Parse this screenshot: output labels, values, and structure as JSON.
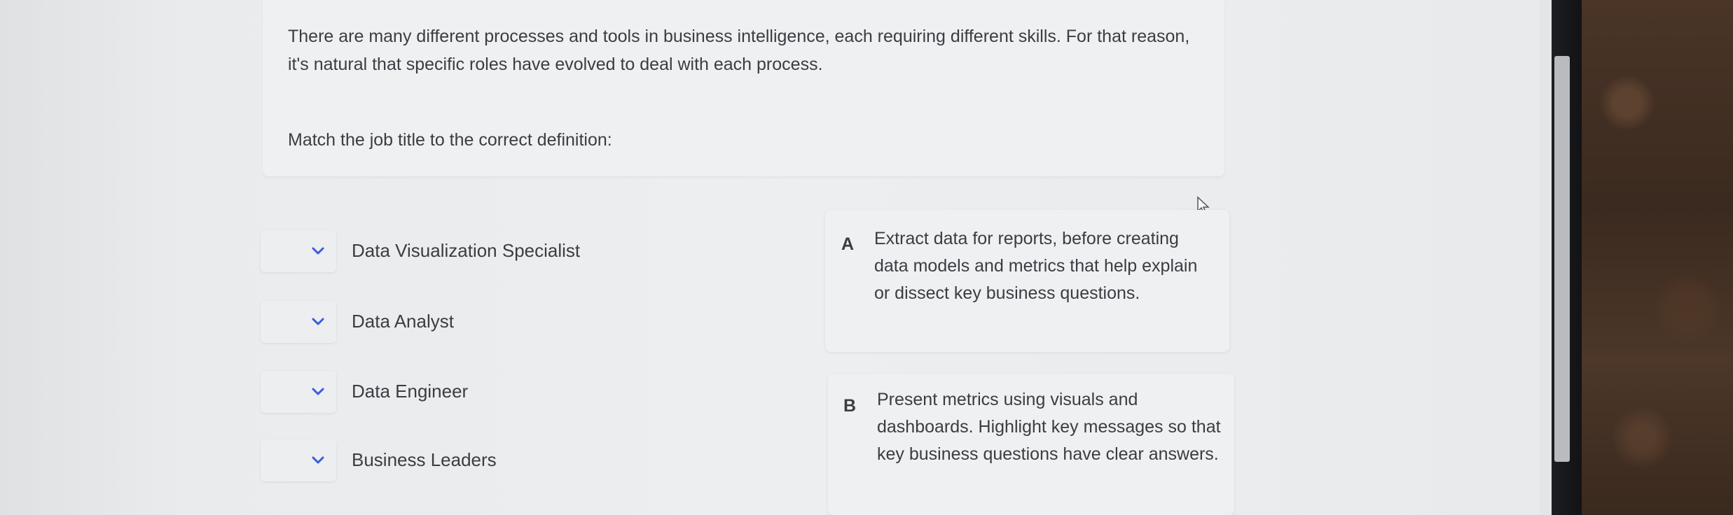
{
  "question": {
    "prompt": "There are many different processes and tools in business intelligence, each requiring different skills. For that reason, it's natural that specific roles have evolved to deal with each process.",
    "instruction": "Match the job title to the correct definition:"
  },
  "job_titles": [
    {
      "label": "Data Visualization Specialist",
      "icon": "chevron-down-icon"
    },
    {
      "label": "Data Analyst",
      "icon": "chevron-down-icon"
    },
    {
      "label": "Data Engineer",
      "icon": "chevron-down-icon"
    },
    {
      "label": "Business Leaders",
      "icon": "chevron-down-icon"
    }
  ],
  "definitions": [
    {
      "letter": "A",
      "text": "Extract data for reports, before creating data models and metrics that help explain or dissect key business questions."
    },
    {
      "letter": "B",
      "text": "Present metrics using visuals and dashboards. Highlight key messages so that key business questions have clear answers."
    }
  ],
  "colors": {
    "accent": "#3b5bdb",
    "text": "#3a3d42",
    "card": "#eef0f2"
  }
}
